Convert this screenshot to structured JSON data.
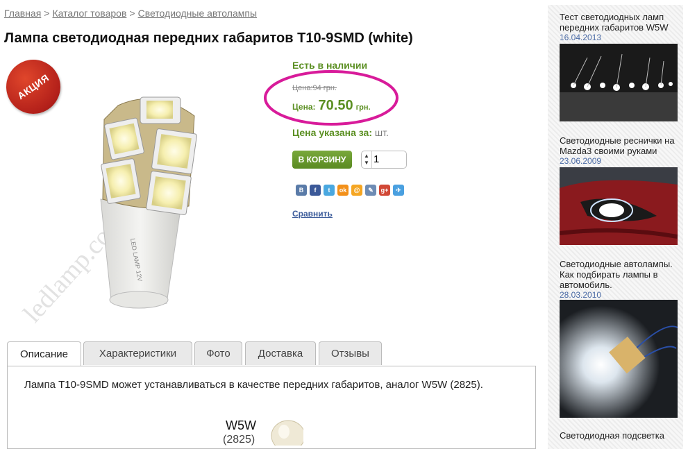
{
  "breadcrumb": {
    "items": [
      "Главная",
      "Каталог товаров",
      "Светодиодные автолампы"
    ],
    "separator": ">"
  },
  "product": {
    "title": "Лампа светодиодная передних габаритов T10-9SMD (white)",
    "sale_badge": "АКЦИЯ",
    "image_label": "LED LAMP 12V",
    "watermark": "ledlamp.com.ua",
    "stock": "Есть в наличии",
    "old_price": "Цена:94 грн.",
    "price_label": "Цена:",
    "price_value": "70.50",
    "price_currency": "грн.",
    "price_note_label": "Цена указана за:",
    "price_note_unit": "шт.",
    "cart_button": "В КОРЗИНУ",
    "quantity": "1",
    "compare": "Сравнить"
  },
  "share": [
    {
      "icon": "vk-icon",
      "glyph": "В",
      "color": "#5a7ba8"
    },
    {
      "icon": "facebook-icon",
      "glyph": "f",
      "color": "#3b5998"
    },
    {
      "icon": "twitter-icon",
      "glyph": "t",
      "color": "#4aa8e0"
    },
    {
      "icon": "odnoklassniki-icon",
      "glyph": "ok",
      "color": "#f39019"
    },
    {
      "icon": "mailru-icon",
      "glyph": "@",
      "color": "#f5a623"
    },
    {
      "icon": "livejournal-icon",
      "glyph": "✎",
      "color": "#6e8cb4"
    },
    {
      "icon": "googleplus-icon",
      "glyph": "g+",
      "color": "#d14836"
    },
    {
      "icon": "yandex-icon",
      "glyph": "✈",
      "color": "#4aa0e0"
    }
  ],
  "tabs": [
    "Описание",
    "Характеристики",
    "Фото",
    "Доставка",
    "Отзывы"
  ],
  "description": {
    "text": "Лампа T10-9SMD может устанавливаться в качестве передних габаритов, аналог W5W (2825).",
    "image_label": "W5W",
    "image_sublabel": "(2825)"
  },
  "sidebar": {
    "news": [
      {
        "title": "Тест светодиодных ламп передних габаритов W5W",
        "date": "16.04.2013"
      },
      {
        "title": "Светодиодные реснички на Mazda3 своими руками",
        "date": "23.06.2009"
      },
      {
        "title": "Светодиодные автолампы. Как подбирать лампы в автомобиль.",
        "date": "28.03.2010"
      },
      {
        "title": "Светодиодная подсветка",
        "date": ""
      }
    ]
  },
  "colors": {
    "accent_green": "#5b8f22",
    "highlight_magenta": "#d81b9a",
    "link_blue": "#3b5b9a",
    "sale_red": "#c0281c"
  }
}
